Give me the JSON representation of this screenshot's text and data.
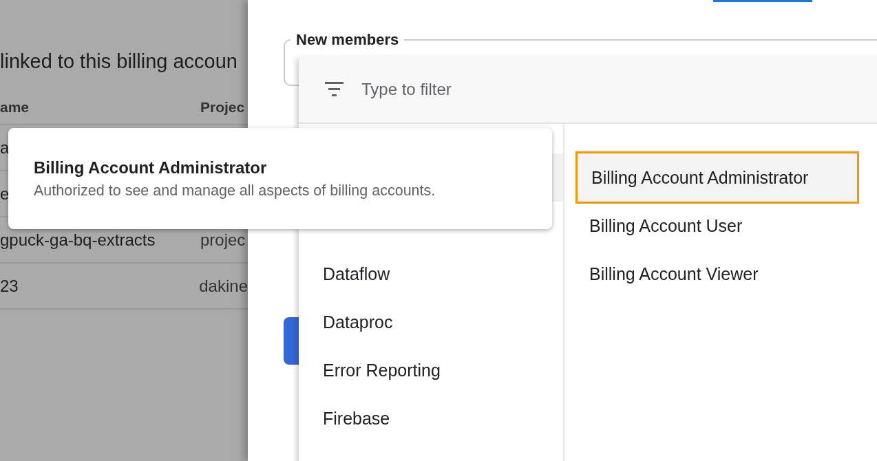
{
  "background_page": {
    "heading": "linked to this billing accoun",
    "columns": [
      "ame",
      "Projec"
    ],
    "rows": [
      {
        "cells": [
          "a"
        ]
      },
      {
        "cells": [
          "e"
        ]
      },
      {
        "cells": [
          "gpuck-ga-bq-extracts",
          "projec"
        ]
      },
      {
        "cells": [
          "23",
          "dakine"
        ]
      }
    ]
  },
  "panel": {
    "members_field": {
      "label": "New members"
    },
    "role_menu": {
      "filter": {
        "placeholder": "Type to filter"
      },
      "categories": [
        {
          "label": "Dataflow",
          "selected": false
        },
        {
          "label": "Dataproc",
          "selected": false
        },
        {
          "label": "Error Reporting",
          "selected": false
        },
        {
          "label": "Firebase",
          "selected": false
        }
      ],
      "roles": [
        {
          "label": "Billing Account Administrator",
          "selected": true
        },
        {
          "label": "Billing Account User",
          "selected": false
        },
        {
          "label": "Billing Account Viewer",
          "selected": false
        }
      ]
    }
  },
  "tooltip": {
    "title": "Billing Account Administrator",
    "description": "Authorized to see and manage all aspects of billing accounts."
  }
}
